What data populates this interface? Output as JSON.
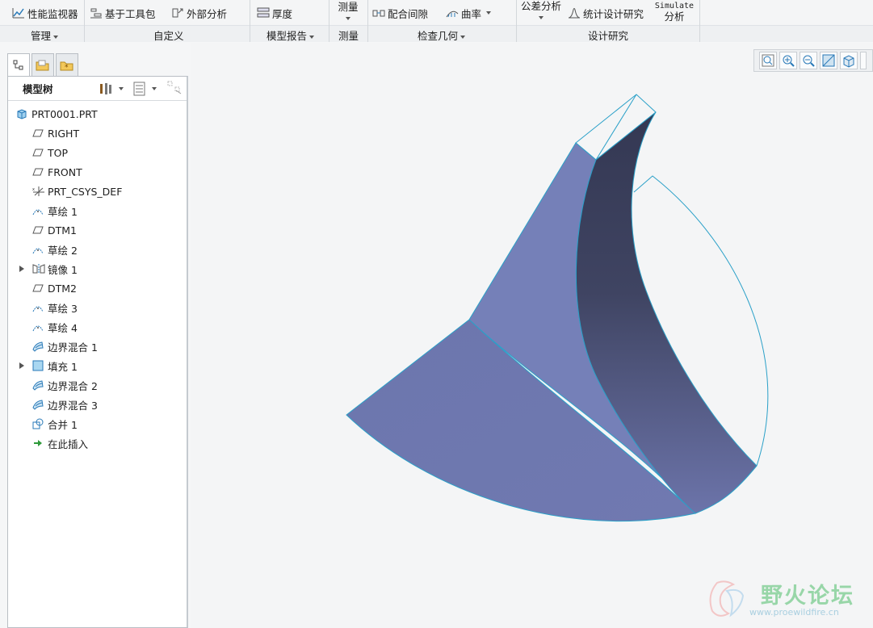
{
  "ribbon": {
    "row1": {
      "perf_monitor": "性能监视器",
      "toolkit": "基于工具包",
      "external_analysis": "外部分析",
      "thickness": "厚度",
      "measure": "测量",
      "clearance": "配合间隙",
      "curvature": "曲率",
      "tolerance": "公差分析",
      "stat_design": "统计设计研究",
      "simulate_top": "Simulate",
      "simulate_bottom": "分析"
    },
    "groups": {
      "manage": "管理",
      "custom": "自定义",
      "model_report": "模型报告",
      "measure": "测量",
      "inspect_geometry": "检查几何",
      "design_study": "设计研究"
    }
  },
  "panel": {
    "title": "模型树",
    "tree": [
      {
        "label": "PRT0001.PRT",
        "icon": "part-icon"
      },
      {
        "label": "RIGHT",
        "icon": "datum-plane-icon"
      },
      {
        "label": "TOP",
        "icon": "datum-plane-icon"
      },
      {
        "label": "FRONT",
        "icon": "datum-plane-icon"
      },
      {
        "label": "PRT_CSYS_DEF",
        "icon": "csys-icon"
      },
      {
        "label": "草绘 1",
        "icon": "sketch-icon"
      },
      {
        "label": "DTM1",
        "icon": "datum-plane-icon"
      },
      {
        "label": "草绘 2",
        "icon": "sketch-icon"
      },
      {
        "label": "镜像 1",
        "icon": "mirror-icon",
        "expandable": true
      },
      {
        "label": "DTM2",
        "icon": "datum-plane-icon"
      },
      {
        "label": "草绘 3",
        "icon": "sketch-icon"
      },
      {
        "label": "草绘 4",
        "icon": "sketch-icon"
      },
      {
        "label": "边界混合 1",
        "icon": "boundary-blend-icon"
      },
      {
        "label": "填充 1",
        "icon": "fill-icon",
        "expandable": true
      },
      {
        "label": "边界混合 2",
        "icon": "boundary-blend-icon"
      },
      {
        "label": "边界混合 3",
        "icon": "boundary-blend-icon"
      },
      {
        "label": "合并 1",
        "icon": "merge-icon"
      },
      {
        "label": "在此插入",
        "icon": "insert-here-icon"
      }
    ]
  },
  "watermark": {
    "title": "野火论坛",
    "url": "www.proewildfire.cn"
  },
  "colors": {
    "surface_light": "#7680b8",
    "surface_dark": "#3a3f5e",
    "edge": "#2aa0c8",
    "accent_icon": "#2a7ab8"
  }
}
